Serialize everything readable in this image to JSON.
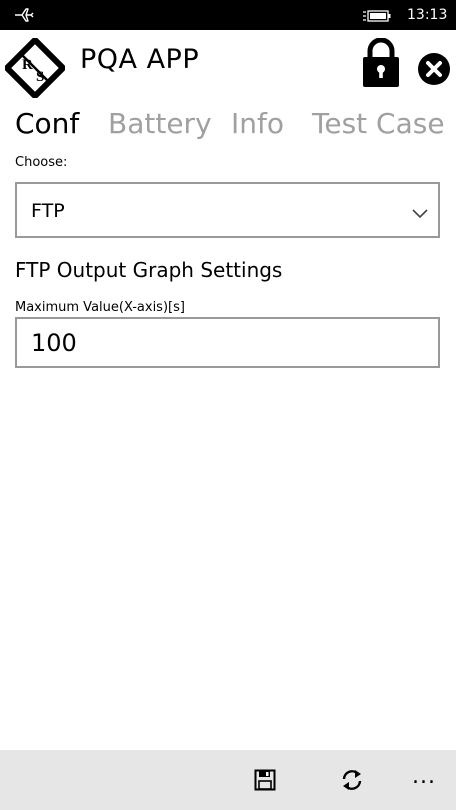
{
  "status_bar": {
    "airplane_icon": "airplane-icon",
    "battery_icon": "battery-charging-icon",
    "time": "13:13"
  },
  "header": {
    "logo_text": "RS",
    "title": "PQA APP",
    "lock_icon": "lock-icon",
    "close_icon": "close-icon"
  },
  "tabs": [
    {
      "label": "Conf",
      "active": true
    },
    {
      "label": "Battery",
      "active": false
    },
    {
      "label": "Info",
      "active": false
    },
    {
      "label": "Test Case",
      "active": false
    }
  ],
  "form": {
    "choose_label": "Choose:",
    "choose_value": "FTP",
    "section_title": "FTP Output Graph Settings",
    "max_label": "Maximum Value(X-axis)[s]",
    "max_value": "100"
  },
  "app_bar": {
    "save_icon": "save-icon",
    "sync_icon": "sync-icon",
    "more_label": "..."
  },
  "colors": {
    "status_bar_bg": "#000000",
    "tab_inactive": "#a0a0a0",
    "border": "#999999",
    "app_bar_bg": "#e6e6e6"
  }
}
